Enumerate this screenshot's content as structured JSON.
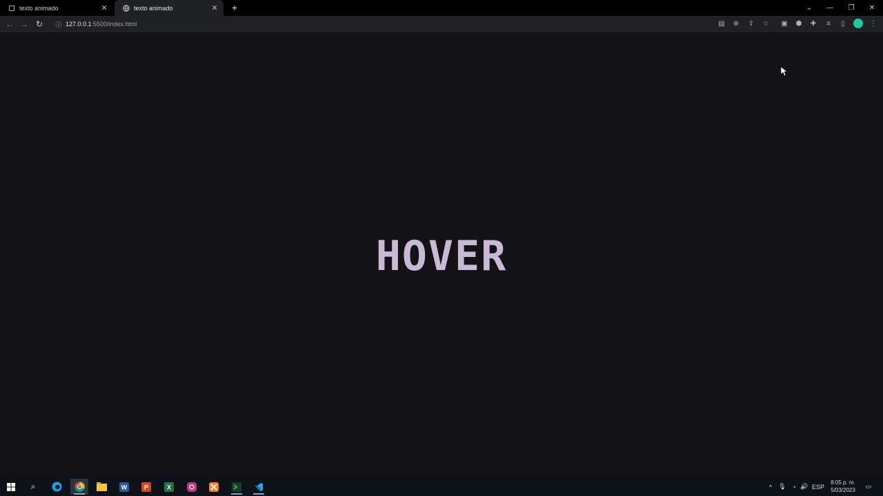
{
  "browser": {
    "tabs": [
      {
        "title": "texto animado",
        "active": false
      },
      {
        "title": "texto animado",
        "active": true
      }
    ],
    "url_host": "127.0.0.1",
    "url_rest": ":5500/index.html"
  },
  "page": {
    "heading": "HOVER"
  },
  "taskbar": {
    "language": "ESP",
    "time": "8:05 p. m.",
    "date": "5/03/2023"
  },
  "colors": {
    "page_bg": "#131316",
    "heading": "#c8bad4",
    "accent_teal": "#1ec8a0"
  }
}
